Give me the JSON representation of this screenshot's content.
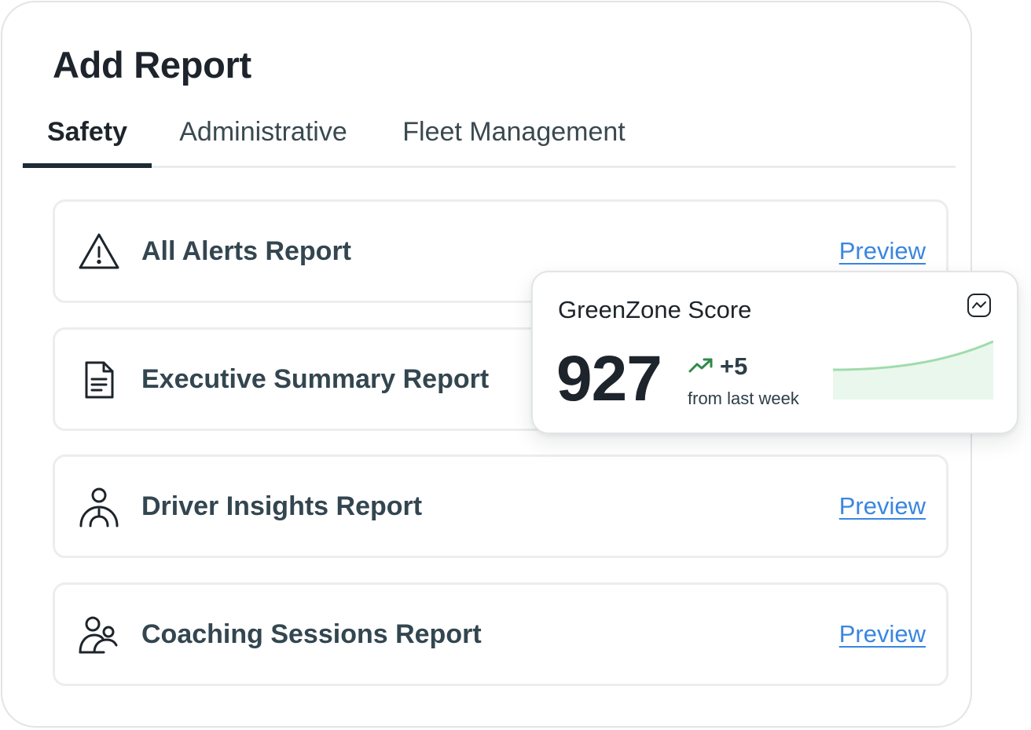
{
  "page": {
    "title": "Add Report"
  },
  "tabs": [
    {
      "label": "Safety",
      "active": true
    },
    {
      "label": "Administrative",
      "active": false
    },
    {
      "label": "Fleet Management",
      "active": false
    }
  ],
  "reports": [
    {
      "name": "All Alerts Report",
      "icon": "alert-triangle-icon",
      "preview_label": "Preview"
    },
    {
      "name": "Executive Summary Report",
      "icon": "document-icon",
      "preview_label": "Preview"
    },
    {
      "name": "Driver Insights Report",
      "icon": "driver-icon",
      "preview_label": "Preview"
    },
    {
      "name": "Coaching Sessions Report",
      "icon": "people-icon",
      "preview_label": "Preview"
    }
  ],
  "score_card": {
    "title": "GreenZone Score",
    "value": "927",
    "change": "+5",
    "caption": "from last week",
    "trend": "up",
    "chart_icon": "chart-icon"
  },
  "colors": {
    "link": "#3a86e0",
    "trend_up": "#2f8a4a",
    "sparkline_stroke": "#9fdcac",
    "sparkline_fill": "#e9f7ec",
    "text_dark": "#1d242b",
    "text_muted": "#334650"
  }
}
